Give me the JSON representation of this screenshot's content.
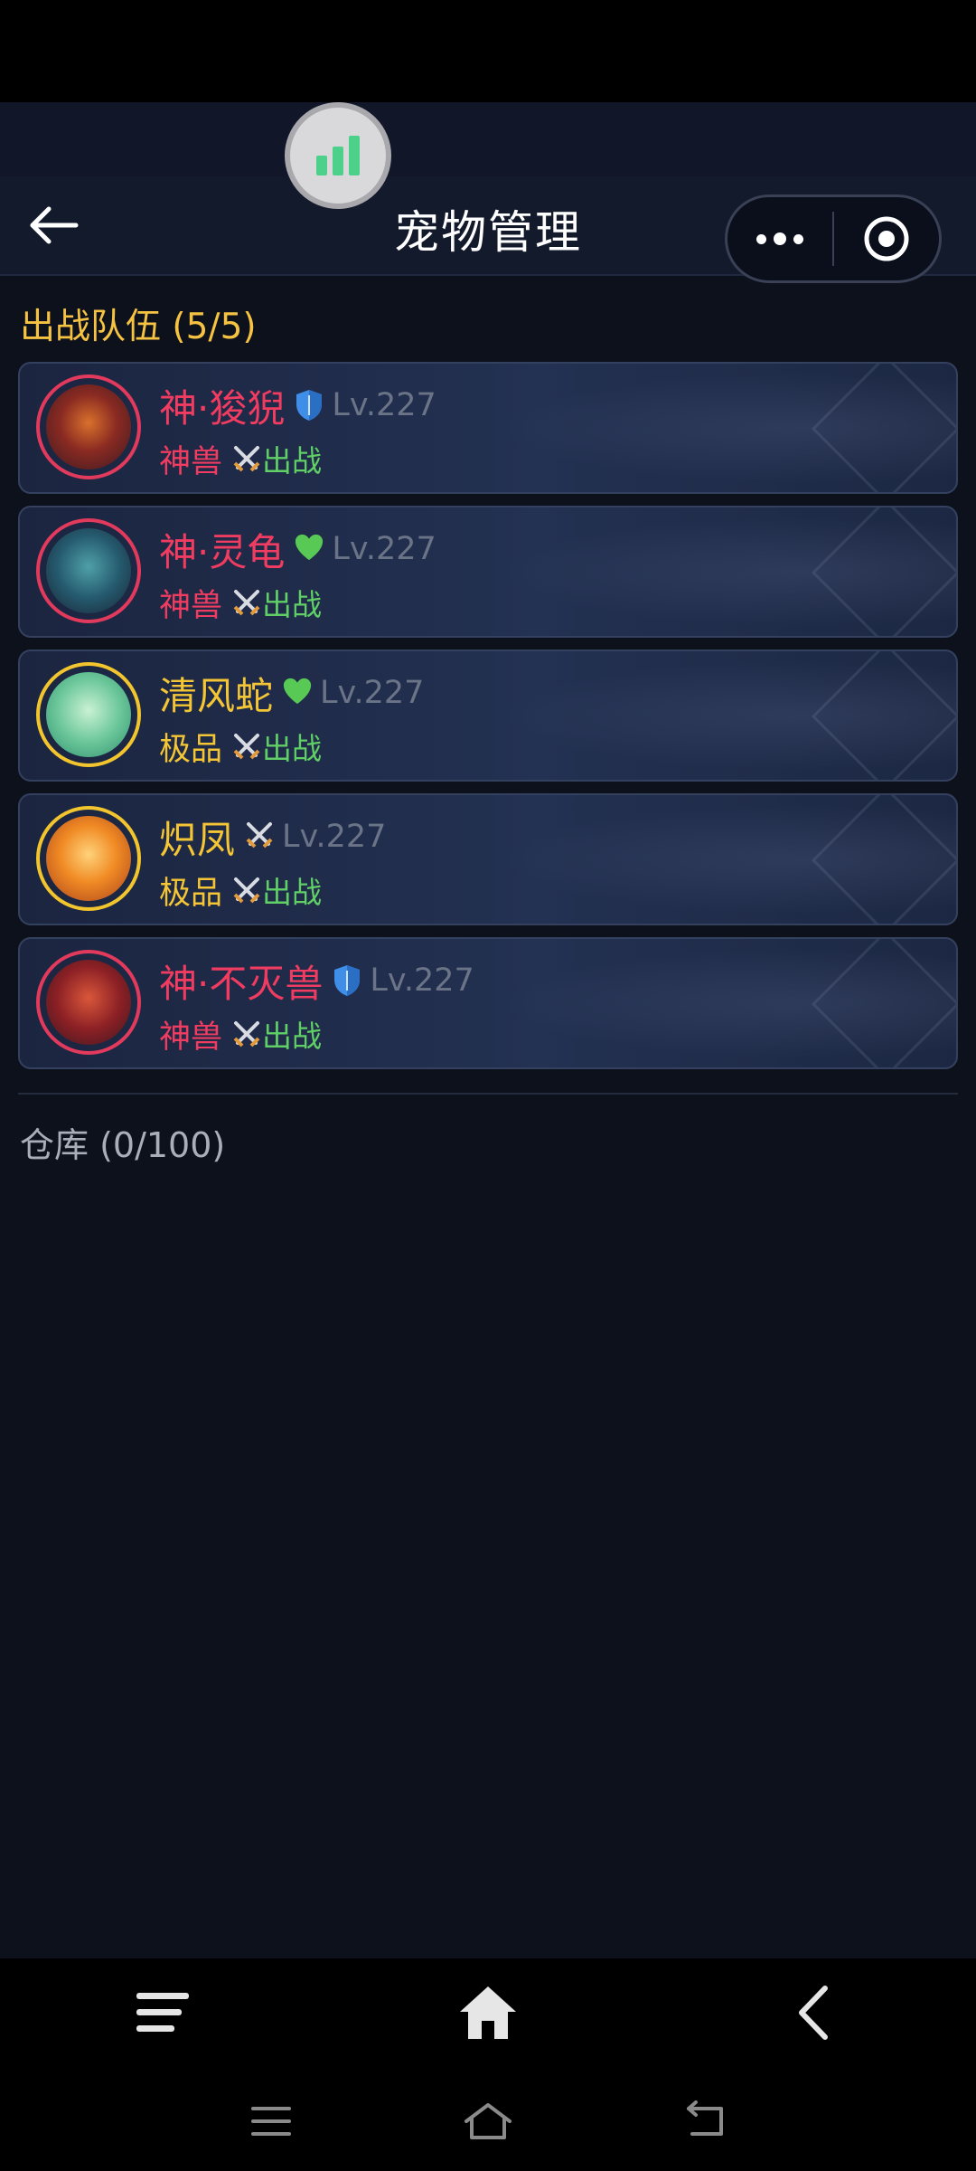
{
  "header": {
    "title": "宠物管理"
  },
  "team": {
    "title": "出战队伍 (5/5)",
    "pets": [
      {
        "name": "神·狻猊",
        "badge_icon": "shield-icon",
        "level": "Lv.227",
        "rarity": "神兽",
        "status": "出战"
      },
      {
        "name": "神·灵龟",
        "badge_icon": "heart-icon",
        "level": "Lv.227",
        "rarity": "神兽",
        "status": "出战"
      },
      {
        "name": "清风蛇",
        "badge_icon": "heart-icon",
        "level": "Lv.227",
        "rarity": "极品",
        "status": "出战"
      },
      {
        "name": "炽凤",
        "badge_icon": "swords-icon",
        "level": "Lv.227",
        "rarity": "极品",
        "status": "出战"
      },
      {
        "name": "神·不灭兽",
        "badge_icon": "shield-icon",
        "level": "Lv.227",
        "rarity": "神兽",
        "status": "出战"
      }
    ]
  },
  "warehouse": {
    "title": "仓库 (0/100)"
  },
  "colors": {
    "divine_red": "#f03c61",
    "premium_gold": "#f4c535",
    "battle_green": "#5fcf66",
    "section_gold": "#f5c242",
    "background": "#0d111c"
  }
}
